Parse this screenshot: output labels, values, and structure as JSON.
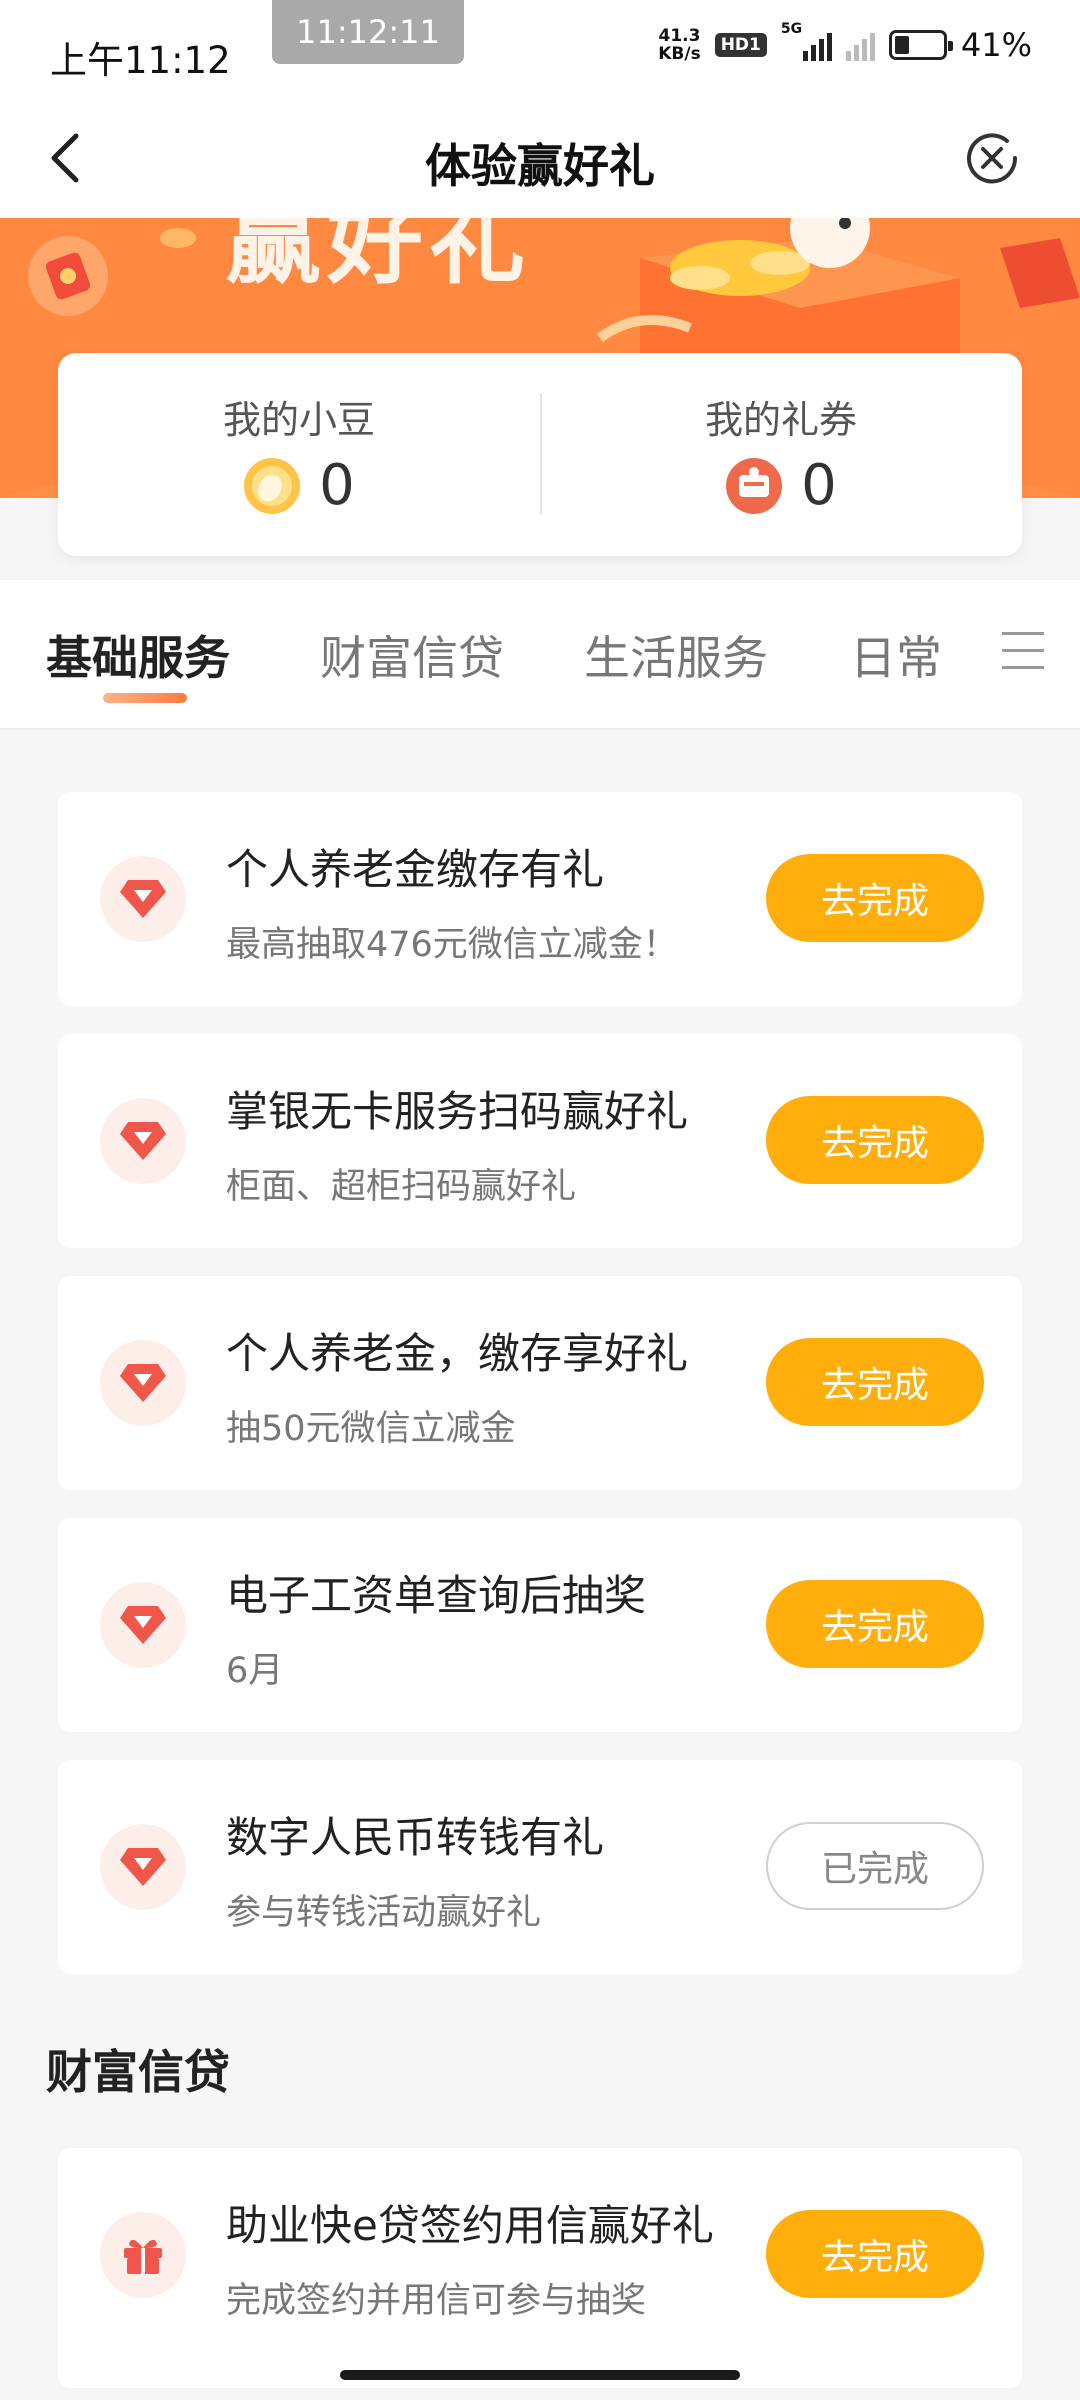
{
  "status_bar": {
    "time": "上午11:12",
    "clock_chip": "11:12:11",
    "net_speed_value": "41.3",
    "net_speed_unit": "KB/s",
    "hd_badge": "HD1",
    "network": "5G",
    "battery": "41%",
    "battery_level": 0.41
  },
  "nav": {
    "title": "体验赢好礼"
  },
  "banner": {
    "title": "赢好礼"
  },
  "summary": {
    "beans_label": "我的小豆",
    "beans_value": "0",
    "coupons_label": "我的礼券",
    "coupons_value": "0"
  },
  "tabs": [
    {
      "label": "基础服务",
      "active": true
    },
    {
      "label": "财富信贷",
      "active": false
    },
    {
      "label": "生活服务",
      "active": false
    },
    {
      "label": "日常",
      "active": false
    }
  ],
  "tasks": [
    {
      "title": "个人养老金缴存有礼",
      "subtitle": "最高抽取476元微信立减金！",
      "button": "去完成",
      "icon": "diamond-icon"
    },
    {
      "title": "掌银无卡服务扫码赢好礼",
      "subtitle": "柜面、超柜扫码赢好礼",
      "button": "去完成",
      "icon": "diamond-icon"
    },
    {
      "title": "个人养老金，缴存享好礼",
      "subtitle": "抽50元微信立减金",
      "button": "去完成",
      "icon": "diamond-icon"
    },
    {
      "title": "电子工资单查询后抽奖",
      "subtitle": "6月",
      "button": "去完成",
      "icon": "diamond-icon"
    },
    {
      "title": "数字人民币转钱有礼",
      "subtitle": "参与转钱活动赢好礼",
      "button": "已完成",
      "icon": "diamond-icon"
    }
  ],
  "section2": {
    "title": "财富信贷",
    "tasks": [
      {
        "title": "助业快e贷签约用信赢好礼",
        "subtitle": "完成签约并用信可参与抽奖",
        "button": "去完成",
        "icon": "gift-icon"
      }
    ]
  },
  "colors": {
    "accent": "#ffae0b",
    "banner": "#ff8a3e",
    "icon_red": "#f0564a"
  }
}
